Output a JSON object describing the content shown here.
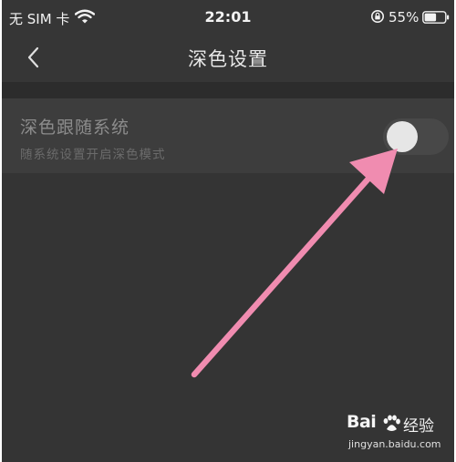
{
  "status_bar": {
    "carrier": "无 SIM 卡",
    "time": "22:01",
    "battery_percent": "55%",
    "icons": [
      "wifi-icon",
      "rotation-lock-icon",
      "battery-icon"
    ]
  },
  "nav": {
    "back_icon": "chevron-left-icon",
    "title": "深色设置"
  },
  "setting": {
    "label": "深色跟随系统",
    "description": "随系统设置开启深色模式",
    "toggle_on": false
  },
  "annotation": {
    "arrow_color": "#f08cb0"
  },
  "watermark": {
    "logo_prefix": "Bai",
    "logo_suffix": "经验",
    "url": "jingyan.baidu.com"
  },
  "colors": {
    "background": "#363636",
    "row_background": "#3d3d3d",
    "label_text": "#8c8c8c"
  }
}
